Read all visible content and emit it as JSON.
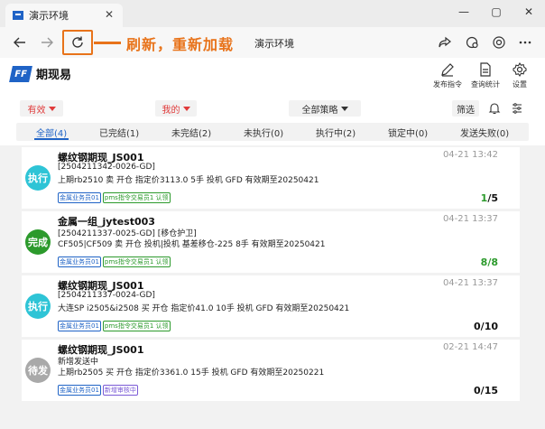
{
  "browser": {
    "tab_title": "演示环境",
    "address_title": "演示环境",
    "annotation": "刷新，重新加载",
    "annotation_color": "#e8731a"
  },
  "app": {
    "name": "期现易",
    "brand_color": "#1f63c6",
    "header_actions": [
      {
        "label": "发布指令",
        "icon": "pen-icon"
      },
      {
        "label": "查询统计",
        "icon": "document-icon"
      },
      {
        "label": "设置",
        "icon": "gear-icon"
      }
    ]
  },
  "filters": {
    "validity": "有效",
    "mine": "我的",
    "strategy": "全部策略",
    "filter_button": "筛选"
  },
  "status_tabs": [
    {
      "label": "全部(4)",
      "active": true
    },
    {
      "label": "已完结(1)"
    },
    {
      "label": "未完结(2)"
    },
    {
      "label": "未执行(0)"
    },
    {
      "label": "执行中(2)"
    },
    {
      "label": "锁定中(0)"
    },
    {
      "label": "发送失败(0)"
    }
  ],
  "orders": [
    {
      "status": "执行",
      "status_color": "#2ec4d6",
      "title": "螺纹钢期现_JS001",
      "time": "04-21 13:42",
      "line1": "[2504211342-0026-GD]",
      "line2": "上期rb2510 卖 开仓 指定价3113.0 5手 投机 GFD 有效期至20250421",
      "tags": [
        {
          "text": "金属业务员01",
          "color": "blue"
        },
        {
          "text": "pms指令交易员1 认领",
          "color": "green"
        }
      ],
      "done": "1",
      "total": "/5"
    },
    {
      "status": "完成",
      "status_color": "#2c9a2c",
      "title": "金属一组_jytest003",
      "time": "04-21 13:37",
      "line1": "[2504211337-0025-GD] [移仓护卫]",
      "line2": "CF505|CF509 卖 开仓 投机|投机 基差移仓-225 8手 有效期至20250421",
      "tags": [
        {
          "text": "金属业务员01",
          "color": "blue"
        },
        {
          "text": "pms指令交易员1 认领",
          "color": "green"
        }
      ],
      "done": "8",
      "total": "/8"
    },
    {
      "status": "执行",
      "status_color": "#2ec4d6",
      "title": "螺纹钢期现_JS001",
      "time": "04-21 13:37",
      "line1": "[2504211337-0024-GD]",
      "line2": "大连SP i2505&i2508 买 开仓 指定价41.0 10手 投机 GFD 有效期至20250421",
      "tags": [
        {
          "text": "金属业务员01",
          "color": "blue"
        },
        {
          "text": "pms指令交易员1 认领",
          "color": "green"
        }
      ],
      "done": "0",
      "total": "/10"
    },
    {
      "status": "待发",
      "status_color": "#a9a9a9",
      "title": "螺纹钢期现_JS001",
      "time": "02-21 14:47",
      "line1": "新增发送中",
      "line2": "上期rb2505 买 开仓 指定价3361.0 15手 投机 GFD 有效期至20250221",
      "tags": [
        {
          "text": "金属业务员01",
          "color": "blue"
        },
        {
          "text": "新增审核中",
          "color": "purple"
        }
      ],
      "done": "0",
      "total": "/15"
    }
  ]
}
